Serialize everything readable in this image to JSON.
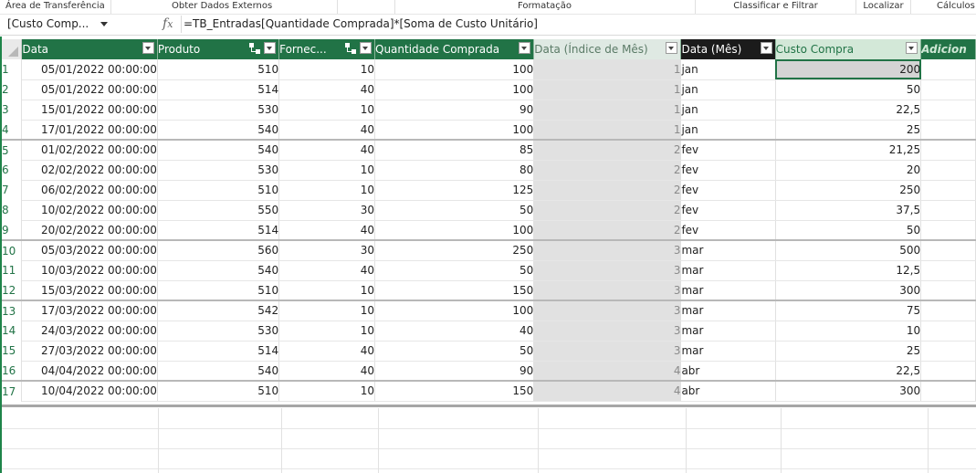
{
  "ribbon": {
    "groups": [
      "Área de Transferência",
      "Obter Dados Externos",
      "Formatação",
      "Classificar e Filtrar",
      "Localizar",
      "Cálculos"
    ]
  },
  "formula_bar": {
    "name_box": "[Custo Comp...",
    "fx": "fx",
    "formula": "=TB_Entradas[Quantidade Comprada]*[Soma de Custo Unitário]"
  },
  "columns": [
    "Data",
    "Produto",
    "Fornec...",
    "Quantidade Comprada",
    "Data (Índice de Mês)",
    "Data (Mês)",
    "Custo Compra",
    "Adicion"
  ],
  "rows": [
    {
      "n": "1",
      "data": "05/01/2022 00:00:00",
      "produto": "510",
      "fornec": "10",
      "qtd": "100",
      "idx": "1",
      "mes": "jan",
      "custo": "200"
    },
    {
      "n": "2",
      "data": "05/01/2022 00:00:00",
      "produto": "514",
      "fornec": "40",
      "qtd": "100",
      "idx": "1",
      "mes": "jan",
      "custo": "50"
    },
    {
      "n": "3",
      "data": "15/01/2022 00:00:00",
      "produto": "530",
      "fornec": "10",
      "qtd": "90",
      "idx": "1",
      "mes": "jan",
      "custo": "22,5"
    },
    {
      "n": "4",
      "data": "17/01/2022 00:00:00",
      "produto": "540",
      "fornec": "40",
      "qtd": "100",
      "idx": "1",
      "mes": "jan",
      "custo": "25"
    },
    {
      "n": "5",
      "data": "01/02/2022 00:00:00",
      "produto": "540",
      "fornec": "40",
      "qtd": "85",
      "idx": "2",
      "mes": "fev",
      "custo": "21,25"
    },
    {
      "n": "6",
      "data": "02/02/2022 00:00:00",
      "produto": "530",
      "fornec": "10",
      "qtd": "80",
      "idx": "2",
      "mes": "fev",
      "custo": "20"
    },
    {
      "n": "7",
      "data": "06/02/2022 00:00:00",
      "produto": "510",
      "fornec": "10",
      "qtd": "125",
      "idx": "2",
      "mes": "fev",
      "custo": "250"
    },
    {
      "n": "8",
      "data": "10/02/2022 00:00:00",
      "produto": "550",
      "fornec": "30",
      "qtd": "50",
      "idx": "2",
      "mes": "fev",
      "custo": "37,5"
    },
    {
      "n": "9",
      "data": "20/02/2022 00:00:00",
      "produto": "514",
      "fornec": "40",
      "qtd": "100",
      "idx": "2",
      "mes": "fev",
      "custo": "50"
    },
    {
      "n": "10",
      "data": "05/03/2022 00:00:00",
      "produto": "560",
      "fornec": "30",
      "qtd": "250",
      "idx": "3",
      "mes": "mar",
      "custo": "500"
    },
    {
      "n": "11",
      "data": "10/03/2022 00:00:00",
      "produto": "540",
      "fornec": "40",
      "qtd": "50",
      "idx": "3",
      "mes": "mar",
      "custo": "12,5"
    },
    {
      "n": "12",
      "data": "15/03/2022 00:00:00",
      "produto": "510",
      "fornec": "10",
      "qtd": "150",
      "idx": "3",
      "mes": "mar",
      "custo": "300"
    },
    {
      "n": "13",
      "data": "17/03/2022 00:00:00",
      "produto": "542",
      "fornec": "10",
      "qtd": "100",
      "idx": "3",
      "mes": "mar",
      "custo": "75"
    },
    {
      "n": "14",
      "data": "24/03/2022 00:00:00",
      "produto": "530",
      "fornec": "10",
      "qtd": "40",
      "idx": "3",
      "mes": "mar",
      "custo": "10"
    },
    {
      "n": "15",
      "data": "27/03/2022 00:00:00",
      "produto": "514",
      "fornec": "40",
      "qtd": "50",
      "idx": "3",
      "mes": "mar",
      "custo": "25"
    },
    {
      "n": "16",
      "data": "04/04/2022 00:00:00",
      "produto": "540",
      "fornec": "40",
      "qtd": "90",
      "idx": "4",
      "mes": "abr",
      "custo": "22,5"
    },
    {
      "n": "17",
      "data": "10/04/2022 00:00:00",
      "produto": "510",
      "fornec": "10",
      "qtd": "150",
      "idx": "4",
      "mes": "abr",
      "custo": "300"
    }
  ],
  "colors": {
    "header_green": "#217346",
    "calc_gray": "#e1e1e1",
    "selected_header": "#1b1b1b"
  }
}
